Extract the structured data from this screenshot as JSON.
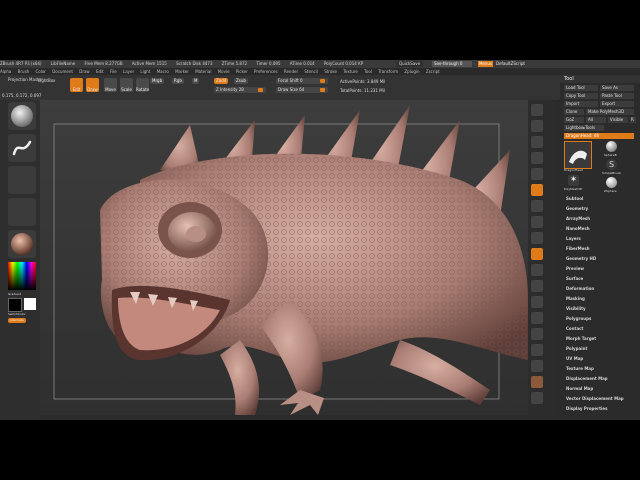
{
  "topbar": {
    "items": [
      "ZBrush 4R7 P3 (x64)",
      "LibFileName",
      "Free Mem 8.277GB",
      "Active Mem 1515",
      "Scratch Disk 4473",
      "ZTime 5.872",
      "Timer 0.095",
      "ATime 0.014",
      "PolyCount 0.014 KP"
    ],
    "quicksave": "QuickSave",
    "see_through": "See-through 0",
    "menus": "Menus",
    "default_zscript": "DefaultZScript"
  },
  "menubar": [
    "Alpha",
    "Brush",
    "Color",
    "Document",
    "Draw",
    "Edit",
    "File",
    "Layer",
    "Light",
    "Macro",
    "Marker",
    "Material",
    "Movie",
    "Picker",
    "Preferences",
    "Render",
    "Stencil",
    "Stroke",
    "Texture",
    "Tool",
    "Transform",
    "Zplugin",
    "Zscript"
  ],
  "toolbar": {
    "projection_master": "Projection Master",
    "lightbox": "LightBox",
    "edit": "Edit",
    "draw": "Draw",
    "move": "Move",
    "scale": "Scale",
    "rotate": "Rotate",
    "mrgb": "Mrgb",
    "rgb": "Rgb",
    "m": "M",
    "zadd": "Zadd",
    "zsub": "Zsub",
    "z_intensity": "Z Intensity 28",
    "focal_shift": "Focal Shift 0",
    "draw_size": "Draw Size 64",
    "active_points": "ActivePoints: 3.849 Mil",
    "total_points": "TotalPoints: 11.231 Mil"
  },
  "coords": "0.175, 0.172, 0.097",
  "left_panel": {
    "gradient": "Gradient",
    "switch_color": "SwitchColor",
    "alternate": "Alternate"
  },
  "colors": {
    "accent": "#e07b1a",
    "clay": "#a97d73",
    "background": "#2b2b2b"
  },
  "tool_panel": {
    "title": "Tool",
    "buttons": [
      "Load Tool",
      "Save As",
      "Copy Tool",
      "Paste Tool",
      "Import",
      "Export",
      "Clone",
      "Make PolyMesh3D",
      "GoZ",
      "All",
      "Visible",
      "R"
    ],
    "lightbox_tools": "Lightbox▸Tools",
    "dragon_label": "DragonHead: 48",
    "thumb_labels": [
      "DragonHead",
      "SphereB",
      "SimpleBrush",
      "PolyMesh3D",
      "ZSphere"
    ],
    "items": [
      "Subtool",
      "Geometry",
      "ArrayMesh",
      "NanoMesh",
      "Layers",
      "FiberMesh",
      "Geometry HD",
      "Preview",
      "Surface",
      "Deformation",
      "Masking",
      "Visibility",
      "Polygroups",
      "Contact",
      "Morph Target",
      "Polypaint",
      "UV Map",
      "Texture Map",
      "Displacement Map",
      "Normal Map",
      "Vector Displacement Map",
      "Display Properties"
    ]
  }
}
